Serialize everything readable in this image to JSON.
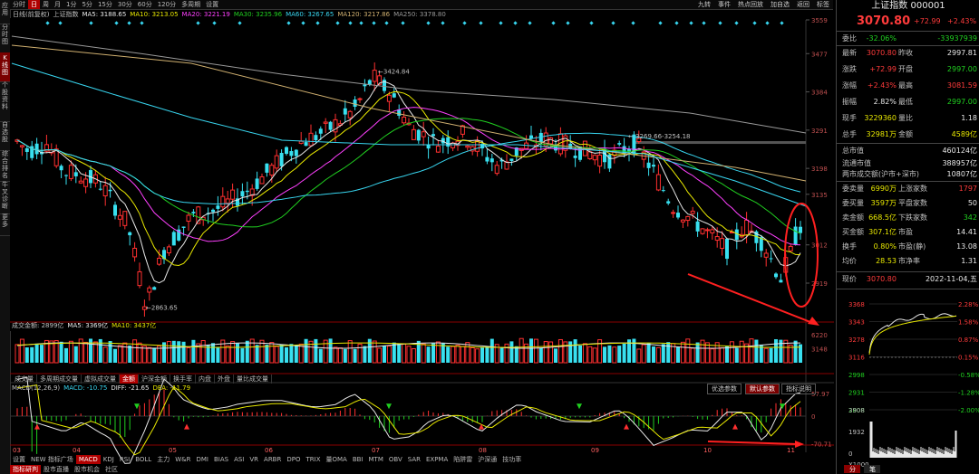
{
  "left_tabs": [
    "应用",
    "分时图",
    "K线图",
    "个股资料",
    "自选股",
    "综合排名",
    "牛叉诊断",
    "更多"
  ],
  "periods": [
    "分时",
    "日",
    "周",
    "月",
    "1分",
    "5分",
    "15分",
    "30分",
    "60分",
    "120分",
    "多周期",
    "设置"
  ],
  "active_period": "日",
  "toolbar_right": [
    "九转",
    "事件",
    "热点回放",
    "加自选",
    "返回",
    "标签"
  ],
  "ma_legend": [
    {
      "text": "日线(前复权)",
      "color": "#c0c0c0"
    },
    {
      "text": "上证指数",
      "color": "#c0c0c0"
    },
    {
      "text": "MA5: 3188.65",
      "color": "#e8e8e8"
    },
    {
      "text": "MA10: 3213.05",
      "color": "#e8e800"
    },
    {
      "text": "MA20: 3221.19",
      "color": "#ff40ff"
    },
    {
      "text": "MA30: 3235.96",
      "color": "#20d020"
    },
    {
      "text": "MA60: 3267.65",
      "color": "#38d6f0"
    },
    {
      "text": "MA120: 3217.86",
      "color": "#d0b070"
    },
    {
      "text": "MA250: 3378.80",
      "color": "#999999"
    }
  ],
  "price_axis": [
    "3559",
    "3477",
    "3384",
    "3291",
    "3198",
    "3135",
    "3012",
    "2919"
  ],
  "price_annotations": {
    "high": "3424.84",
    "low": "2863.65",
    "range": "3269.66-3254.18"
  },
  "volume": {
    "legend": [
      {
        "text": "成交金额: 2899亿",
        "color": "#c0c0c0"
      },
      {
        "text": "MA5: 3369亿",
        "color": "#e8e8e8"
      },
      {
        "text": "MA10: 3437亿",
        "color": "#e8e800"
      }
    ],
    "axis": [
      "6220",
      "3148"
    ]
  },
  "indicator_tabs": [
    "成交量",
    "多周期成交量",
    "虚拟成交量",
    "金额",
    "沪深金额",
    "换手率",
    "内盘",
    "外盘",
    "量比成交量"
  ],
  "active_indicator_tab": "金额",
  "macd": {
    "legend": [
      {
        "text": "MACD(12,26,9)",
        "color": "#c0c0c0"
      },
      {
        "text": "MACD: -10.75",
        "color": "#38d6f0"
      },
      {
        "text": "DIFF: -21.65",
        "color": "#e8e8e8"
      },
      {
        "text": "DEA: -11.79",
        "color": "#e8e800"
      }
    ],
    "axis": [
      "57.97",
      "0",
      "-70.71"
    ],
    "buttons": [
      "优选参数",
      "默认参数",
      "指标说明"
    ],
    "active_button": "默认参数"
  },
  "months": [
    "03",
    "04",
    "05",
    "06",
    "07",
    "08",
    "09",
    "10",
    "11"
  ],
  "bottom_tabs": [
    "设置",
    "NEW 指标广场",
    "MACD",
    "KDJ",
    "RSI",
    "BOLL",
    "主力",
    "W&R",
    "DMI",
    "BIAS",
    "ASI",
    "VR",
    "ARBR",
    "DPO",
    "TRIX",
    "量OMA",
    "BBI",
    "MTM",
    "OBV",
    "SAR",
    "EXPMA",
    "陷阱雷",
    "沪深通",
    "技功率"
  ],
  "active_bottom_tab": "MACD",
  "bottom_tabs2": [
    "指标研判",
    "股市直播",
    "股市机会",
    "社区"
  ],
  "active_bottom_tab2": "指标研判",
  "panel": {
    "title": "上证指数 000001",
    "price": "3070.80",
    "change": "+72.99",
    "pct": "+2.43%",
    "rows": [
      {
        "l": "委比",
        "v": "-32.06%",
        "l2": "",
        "v2": "-33937939",
        "c": "green"
      },
      {
        "l": "最新",
        "v": "3070.80",
        "l2": "昨收",
        "v2": "2997.81",
        "c": "red",
        "c2": "wht"
      },
      {
        "l": "涨跌",
        "v": "+72.99",
        "l2": "开盘",
        "v2": "2997.00",
        "c": "red",
        "c2": "green"
      },
      {
        "l": "涨幅",
        "v": "+2.43%",
        "l2": "最高",
        "v2": "3081.59",
        "c": "red",
        "c2": "red"
      },
      {
        "l": "振幅",
        "v": "2.82%",
        "l2": "最低",
        "v2": "2997.00",
        "c": "wht",
        "c2": "green"
      },
      {
        "l": "现手",
        "v": "3229360",
        "l2": "量比",
        "v2": "1.18",
        "c": "yel",
        "c2": "wht"
      },
      {
        "l": "总手",
        "v": "32981万",
        "l2": "金额",
        "v2": "4589亿",
        "c": "yel",
        "c2": "yel"
      },
      {
        "l": "总市值",
        "v": "",
        "l2": "",
        "v2": "460124亿",
        "c": "wht",
        "c2": "wht"
      },
      {
        "l": "流通市值",
        "v": "",
        "l2": "",
        "v2": "388957亿",
        "c": "wht",
        "c2": "wht"
      },
      {
        "l": "两市成交额(沪市+深市)",
        "v": "",
        "l2": "",
        "v2": "10807亿",
        "c": "wht",
        "c2": "wht"
      },
      {
        "l": "委卖量",
        "v": "6990万",
        "l2": "上涨家数",
        "v2": "1797",
        "c": "yel",
        "c2": "red"
      },
      {
        "l": "委买量",
        "v": "3597万",
        "l2": "平盘家数",
        "v2": "50",
        "c": "yel",
        "c2": "wht"
      },
      {
        "l": "卖金额",
        "v": "668.5亿",
        "l2": "下跌家数",
        "v2": "342",
        "c": "yel",
        "c2": "green"
      },
      {
        "l": "买金额",
        "v": "307.1亿",
        "l2": "市盈",
        "v2": "14.41",
        "c": "yel",
        "c2": "wht"
      },
      {
        "l": "换手",
        "v": "0.80%",
        "l2": "市盈(静)",
        "v2": "13.08",
        "c": "yel",
        "c2": "wht"
      },
      {
        "l": "均价",
        "v": "28.53",
        "l2": "市净率",
        "v2": "1.31",
        "c": "yel",
        "c2": "wht"
      },
      {
        "l": "现价",
        "v": "3070.80",
        "l2": "",
        "v2": "2022-11-04,五",
        "c": "red",
        "c2": "wht"
      }
    ],
    "mini_axis_left": [
      "3368",
      "3343",
      "3278",
      "3116",
      "2998",
      "2931",
      "2808"
    ],
    "mini_axis_right": [
      "2.28%",
      "1.58%",
      "0.87%",
      "0.15%",
      "-0.58%",
      "-1.28%",
      "-2.00%"
    ],
    "mini_vol": [
      "3908",
      "1932",
      "0",
      "X1000"
    ],
    "mini_tabs": [
      "分",
      "笔"
    ]
  },
  "chart_data": [
    {
      "type": "candlestick",
      "title": "上证指数",
      "x": [
        "03",
        "04",
        "05",
        "06",
        "07",
        "08",
        "09",
        "10",
        "11"
      ],
      "ylabels": [
        "3559",
        "3477",
        "3384",
        "3291",
        "3198",
        "3135",
        "3012",
        "2919"
      ],
      "annotations": [
        "3424.84",
        "2863.65",
        "3269.66-3254.18"
      ],
      "series": [
        {
          "name": "MA5",
          "last": 3188.65
        },
        {
          "name": "MA10",
          "last": 3213.05
        },
        {
          "name": "MA20",
          "last": 3221.19
        },
        {
          "name": "MA30",
          "last": 3235.96
        },
        {
          "name": "MA60",
          "last": 3267.65
        },
        {
          "name": "MA120",
          "last": 3217.86
        },
        {
          "name": "MA250",
          "last": 3378.8
        }
      ]
    },
    {
      "type": "bar",
      "title": "成交金额",
      "series": [
        {
          "name": "成交金额",
          "last": 2899
        },
        {
          "name": "MA5",
          "last": 3369
        },
        {
          "name": "MA10",
          "last": 3437
        }
      ],
      "ylabels": [
        "6220",
        "3148"
      ]
    },
    {
      "type": "bar",
      "title": "MACD(12,26,9)",
      "series": [
        {
          "name": "MACD",
          "last": -10.75
        },
        {
          "name": "DIFF",
          "last": -21.65
        },
        {
          "name": "DEA",
          "last": -11.79
        }
      ],
      "ylabels": [
        "57.97",
        "0",
        "-70.71"
      ]
    }
  ]
}
